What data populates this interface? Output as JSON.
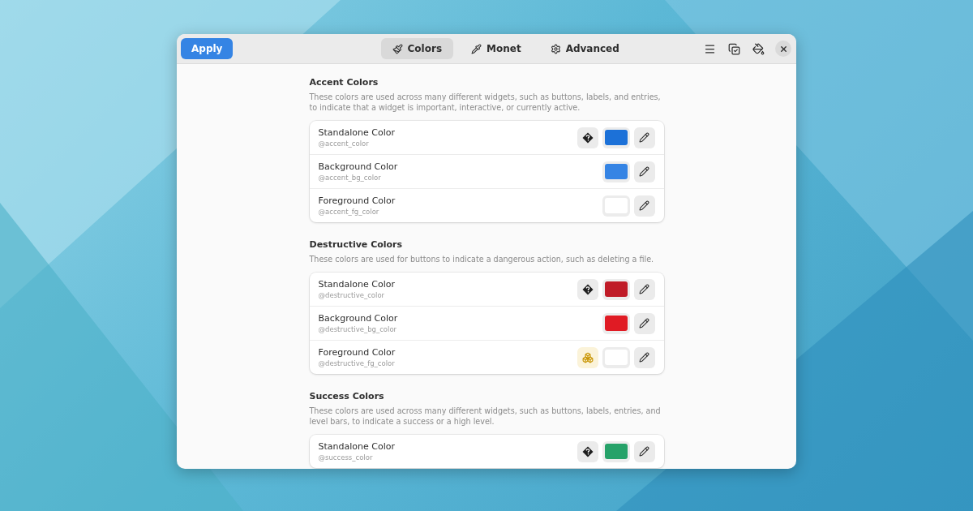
{
  "header": {
    "apply": "Apply",
    "tabs": [
      {
        "label": "Colors",
        "selected": true
      },
      {
        "label": "Monet",
        "selected": false
      },
      {
        "label": "Advanced",
        "selected": false
      }
    ]
  },
  "sections": [
    {
      "title": "Accent Colors",
      "description": "These colors are used across many different widgets, such as buttons, labels, and entries, to indicate that a widget is important, interactive, or currently active.",
      "rows": [
        {
          "name": "Standalone Color",
          "variable": "@accent_color",
          "color": "#1c71d8",
          "kind": "unknown"
        },
        {
          "name": "Background Color",
          "variable": "@accent_bg_color",
          "color": "#3584e4",
          "kind": "plain"
        },
        {
          "name": "Foreground Color",
          "variable": "@accent_fg_color",
          "color": "#ffffff",
          "kind": "plain"
        }
      ]
    },
    {
      "title": "Destructive Colors",
      "description": "These colors are used for buttons to indicate a dangerous action, such as deleting a file.",
      "rows": [
        {
          "name": "Standalone Color",
          "variable": "@destructive_color",
          "color": "#c01c28",
          "kind": "unknown"
        },
        {
          "name": "Background Color",
          "variable": "@destructive_bg_color",
          "color": "#e01b24",
          "kind": "plain"
        },
        {
          "name": "Foreground Color",
          "variable": "@destructive_fg_color",
          "color": "#ffffff",
          "kind": "warning"
        }
      ]
    },
    {
      "title": "Success Colors",
      "description": "These colors are used across many different widgets, such as buttons, labels, entries, and level bars, to indicate a success or a high level.",
      "rows": [
        {
          "name": "Standalone Color",
          "variable": "@success_color",
          "color": "#26a269",
          "kind": "unknown"
        }
      ]
    }
  ]
}
